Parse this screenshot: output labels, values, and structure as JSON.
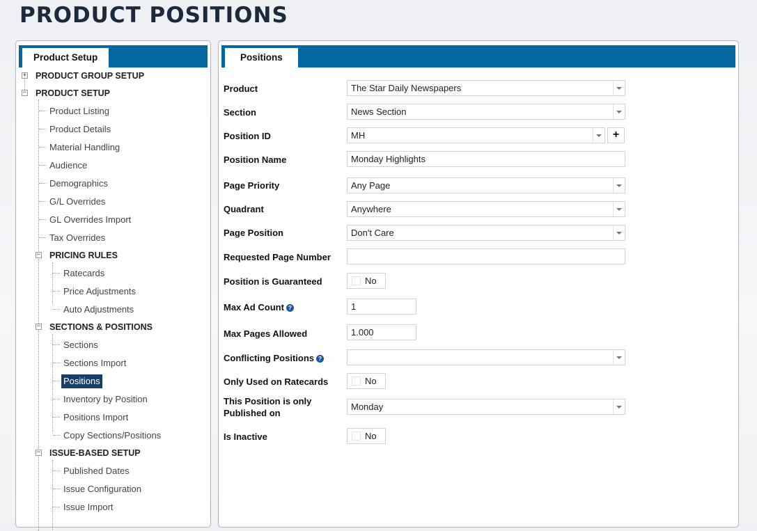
{
  "page": {
    "title": "PRODUCT POSITIONS"
  },
  "left_panel": {
    "tab_label": "Product Setup",
    "tree": [
      {
        "label": "PRODUCT GROUP SETUP",
        "type": "group",
        "toggle": "+"
      },
      {
        "label": "PRODUCT SETUP",
        "type": "group",
        "toggle": "−"
      },
      {
        "label": "Product Listing",
        "type": "leaf"
      },
      {
        "label": "Product Details",
        "type": "leaf"
      },
      {
        "label": "Material Handling",
        "type": "leaf"
      },
      {
        "label": "Audience",
        "type": "leaf"
      },
      {
        "label": "Demographics",
        "type": "leaf"
      },
      {
        "label": "G/L Overrides",
        "type": "leaf"
      },
      {
        "label": "GL Overrides Import",
        "type": "leaf"
      },
      {
        "label": "Tax Overrides",
        "type": "leaf"
      },
      {
        "label": "PRICING RULES",
        "type": "group",
        "toggle": "−"
      },
      {
        "label": "Ratecards",
        "type": "leaf"
      },
      {
        "label": "Price Adjustments",
        "type": "leaf"
      },
      {
        "label": "Auto Adjustments",
        "type": "leaf"
      },
      {
        "label": "SECTIONS & POSITIONS",
        "type": "group",
        "toggle": "−"
      },
      {
        "label": "Sections",
        "type": "leaf"
      },
      {
        "label": "Sections Import",
        "type": "leaf"
      },
      {
        "label": "Positions",
        "type": "leaf",
        "selected": true
      },
      {
        "label": "Inventory by Position",
        "type": "leaf"
      },
      {
        "label": "Positions Import",
        "type": "leaf"
      },
      {
        "label": "Copy Sections/Positions",
        "type": "leaf"
      },
      {
        "label": "ISSUE-BASED SETUP",
        "type": "group",
        "toggle": "−"
      },
      {
        "label": "Published Dates",
        "type": "leaf"
      },
      {
        "label": "Issue Configuration",
        "type": "leaf"
      },
      {
        "label": "Issue Import",
        "type": "leaf"
      }
    ]
  },
  "right_panel": {
    "tab_label": "Positions",
    "form": {
      "product": {
        "label": "Product",
        "value": "The Star Daily Newspapers"
      },
      "section": {
        "label": "Section",
        "value": "News Section"
      },
      "position_id": {
        "label": "Position ID",
        "value": "MH",
        "add_label": "+"
      },
      "position_name": {
        "label": "Position Name",
        "value": "Monday Highlights"
      },
      "page_priority": {
        "label": "Page Priority",
        "value": "Any Page"
      },
      "quadrant": {
        "label": "Quadrant",
        "value": "Anywhere"
      },
      "page_position": {
        "label": "Page Position",
        "value": "Don't Care"
      },
      "requested_page_number": {
        "label": "Requested Page Number",
        "value": ""
      },
      "position_is_guaranteed": {
        "label": "Position is Guaranteed",
        "value": "No"
      },
      "max_ad_count": {
        "label": "Max Ad Count",
        "value": "1"
      },
      "max_pages_allowed": {
        "label": "Max Pages Allowed",
        "value": "1.000"
      },
      "conflicting_positions": {
        "label": "Conflicting Positions",
        "value": ""
      },
      "only_used_on_ratecards": {
        "label": "Only Used on Ratecards",
        "value": "No"
      },
      "published_on": {
        "label_line1": "This Position is only",
        "label_line2": "Published on",
        "value": "Monday"
      },
      "is_inactive": {
        "label": "Is Inactive",
        "value": "No"
      }
    },
    "help_icon": "?"
  },
  "colors": {
    "header_blue": "#04679e",
    "selected_bg": "#163e66",
    "title": "#1c2a3c",
    "help_icon": "#1a56a8"
  }
}
